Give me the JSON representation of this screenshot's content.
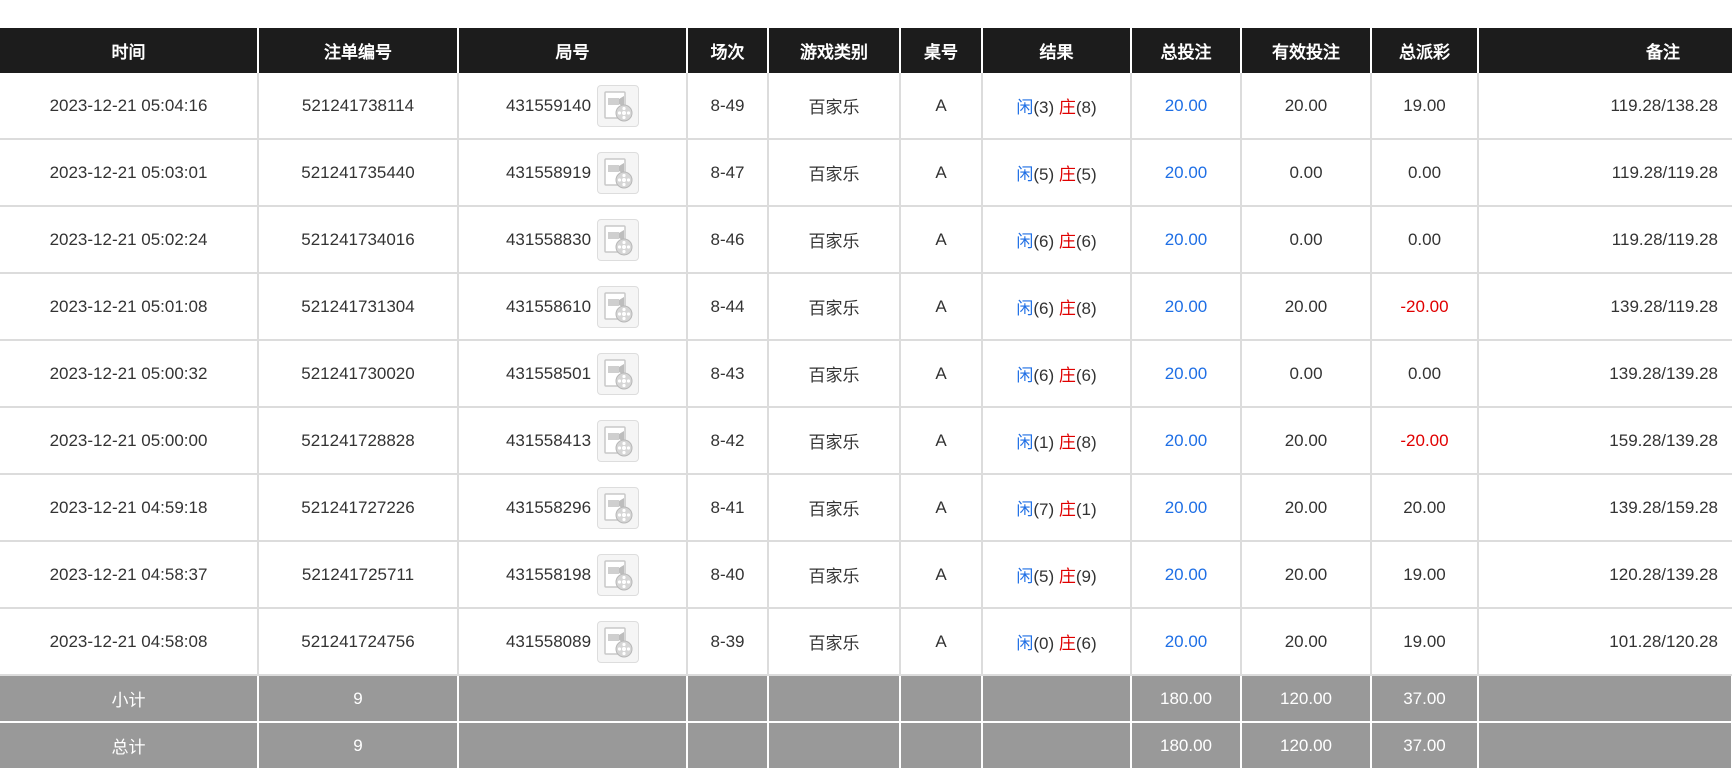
{
  "headers": [
    "时间",
    "注单编号",
    "局号",
    "场次",
    "游戏类别",
    "桌号",
    "结果",
    "总投注",
    "有效投注",
    "总派彩",
    "备注"
  ],
  "labels": {
    "player": "闲",
    "banker": "庄"
  },
  "colors": {
    "header_bg": "#1c1c1c",
    "summary_bg": "#999999",
    "blue": "#1f6fe5",
    "red": "#e00000"
  },
  "rows": [
    {
      "time": "2023-12-21 05:04:16",
      "bet_id": "521241738114",
      "round": "431559140",
      "shoe": "8-49",
      "game": "百家乐",
      "table": "A",
      "player": "(3)",
      "banker": "(8)",
      "total_bet": "20.00",
      "valid_bet": "20.00",
      "payout": "19.00",
      "payout_negative": false,
      "note": "119.28/138.28"
    },
    {
      "time": "2023-12-21 05:03:01",
      "bet_id": "521241735440",
      "round": "431558919",
      "shoe": "8-47",
      "game": "百家乐",
      "table": "A",
      "player": "(5)",
      "banker": "(5)",
      "total_bet": "20.00",
      "valid_bet": "0.00",
      "payout": "0.00",
      "payout_negative": false,
      "note": "119.28/119.28"
    },
    {
      "time": "2023-12-21 05:02:24",
      "bet_id": "521241734016",
      "round": "431558830",
      "shoe": "8-46",
      "game": "百家乐",
      "table": "A",
      "player": "(6)",
      "banker": "(6)",
      "total_bet": "20.00",
      "valid_bet": "0.00",
      "payout": "0.00",
      "payout_negative": false,
      "note": "119.28/119.28"
    },
    {
      "time": "2023-12-21 05:01:08",
      "bet_id": "521241731304",
      "round": "431558610",
      "shoe": "8-44",
      "game": "百家乐",
      "table": "A",
      "player": "(6)",
      "banker": "(8)",
      "total_bet": "20.00",
      "valid_bet": "20.00",
      "payout": "-20.00",
      "payout_negative": true,
      "note": "139.28/119.28"
    },
    {
      "time": "2023-12-21 05:00:32",
      "bet_id": "521241730020",
      "round": "431558501",
      "shoe": "8-43",
      "game": "百家乐",
      "table": "A",
      "player": "(6)",
      "banker": "(6)",
      "total_bet": "20.00",
      "valid_bet": "0.00",
      "payout": "0.00",
      "payout_negative": false,
      "note": "139.28/139.28"
    },
    {
      "time": "2023-12-21 05:00:00",
      "bet_id": "521241728828",
      "round": "431558413",
      "shoe": "8-42",
      "game": "百家乐",
      "table": "A",
      "player": "(1)",
      "banker": "(8)",
      "total_bet": "20.00",
      "valid_bet": "20.00",
      "payout": "-20.00",
      "payout_negative": true,
      "note": "159.28/139.28"
    },
    {
      "time": "2023-12-21 04:59:18",
      "bet_id": "521241727226",
      "round": "431558296",
      "shoe": "8-41",
      "game": "百家乐",
      "table": "A",
      "player": "(7)",
      "banker": "(1)",
      "total_bet": "20.00",
      "valid_bet": "20.00",
      "payout": "20.00",
      "payout_negative": false,
      "note": "139.28/159.28"
    },
    {
      "time": "2023-12-21 04:58:37",
      "bet_id": "521241725711",
      "round": "431558198",
      "shoe": "8-40",
      "game": "百家乐",
      "table": "A",
      "player": "(5)",
      "banker": "(9)",
      "total_bet": "20.00",
      "valid_bet": "20.00",
      "payout": "19.00",
      "payout_negative": false,
      "note": "120.28/139.28"
    },
    {
      "time": "2023-12-21 04:58:08",
      "bet_id": "521241724756",
      "round": "431558089",
      "shoe": "8-39",
      "game": "百家乐",
      "table": "A",
      "player": "(0)",
      "banker": "(6)",
      "total_bet": "20.00",
      "valid_bet": "20.00",
      "payout": "19.00",
      "payout_negative": false,
      "note": "101.28/120.28"
    }
  ],
  "summary": [
    {
      "label": "小计",
      "count": "9",
      "total_bet": "180.00",
      "valid_bet": "120.00",
      "payout": "37.00"
    },
    {
      "label": "总计",
      "count": "9",
      "total_bet": "180.00",
      "valid_bet": "120.00",
      "payout": "37.00"
    }
  ],
  "icons": {
    "replay": "video-replay-icon"
  }
}
